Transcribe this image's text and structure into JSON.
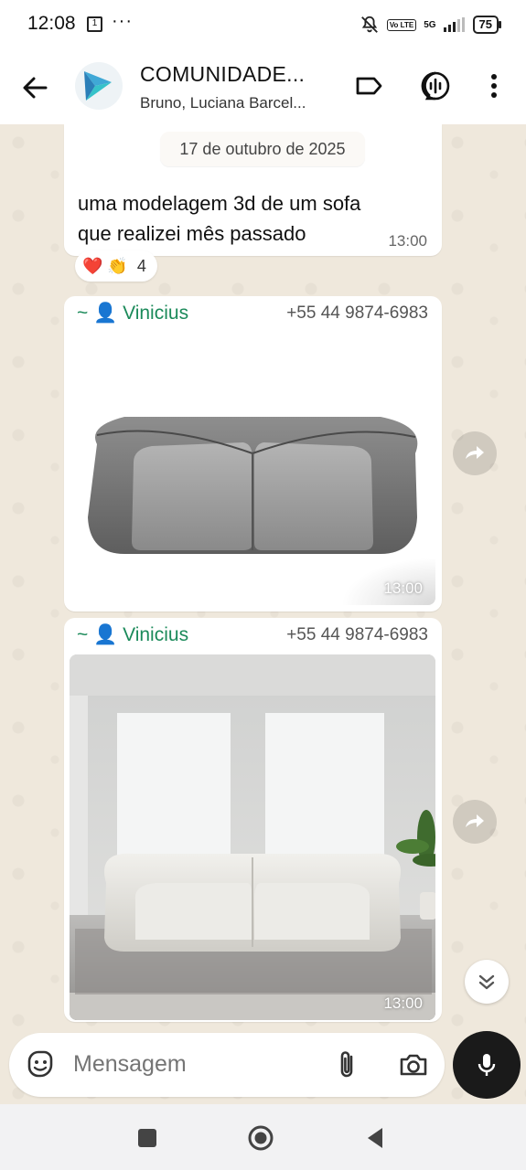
{
  "status_bar": {
    "time": "12:08",
    "notification_badge": "1",
    "more": "···",
    "network": "5G",
    "volte": "Vo LTE",
    "battery": "75"
  },
  "header": {
    "title": "COMUNIDADE...",
    "subtitle": "Bruno, Luciana Barcel..."
  },
  "chat": {
    "date_chip": "17 de outubro de 2025",
    "messages": [
      {
        "text": "uma modelagem 3d de um sofa que realizei mês passado",
        "time": "13:00",
        "reactions": {
          "emojis": "❤️ 👏",
          "count": "4"
        }
      },
      {
        "sender": "~ 👤 Vinicius",
        "phone": "+55 44 9874-6983",
        "time": "13:00"
      },
      {
        "sender": "~ 👤 Vinicius",
        "phone": "+55 44 9874-6983",
        "time": "13:00"
      }
    ]
  },
  "input": {
    "placeholder": "Mensagem"
  },
  "colors": {
    "sender_name": "#1b8a5a",
    "chat_background": "#efe8dc",
    "mic_button": "#1a1a1a"
  },
  "icons": [
    "back-arrow-icon",
    "label-icon",
    "voice-chat-icon",
    "more-vert-icon",
    "forward-icon",
    "chevron-double-down-icon",
    "sticker-icon",
    "attach-icon",
    "camera-icon",
    "mic-icon",
    "nav-recents-icon",
    "nav-home-icon",
    "nav-back-icon"
  ]
}
